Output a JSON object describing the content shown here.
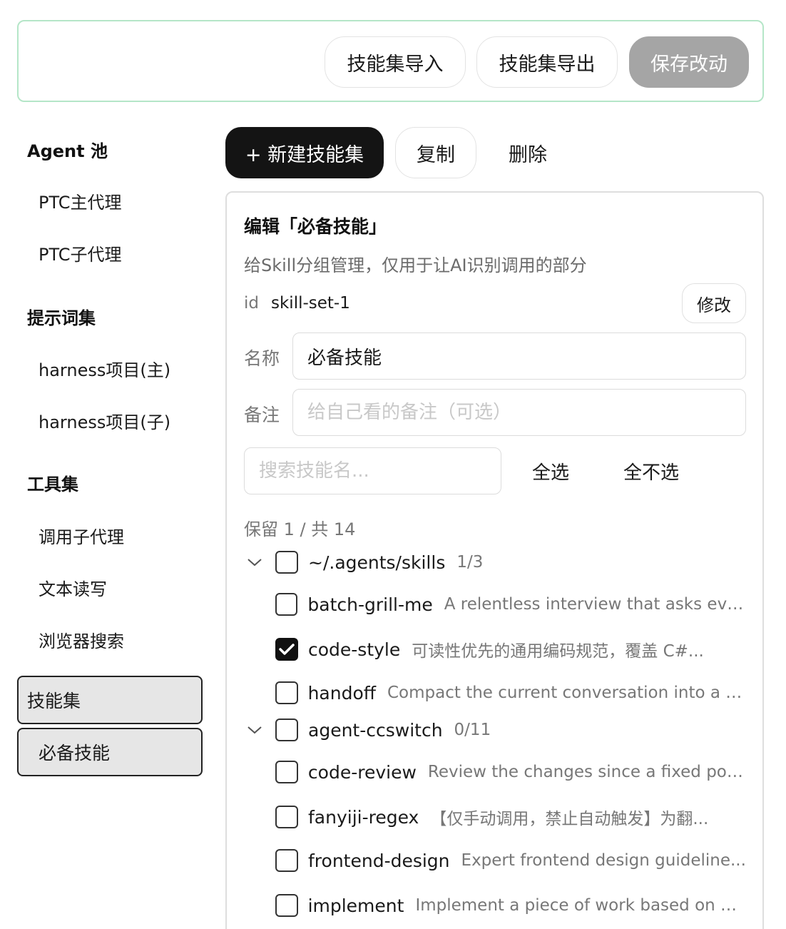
{
  "toolbar": {
    "import_label": "技能集导入",
    "export_label": "技能集导出",
    "save_label": "保存改动"
  },
  "sidebar": {
    "agent_pool_title": "Agent 池",
    "agent_items": [
      "PTC主代理",
      "PTC子代理"
    ],
    "prompt_title": "提示词集",
    "prompt_items": [
      "harness项目(主)",
      "harness项目(子)"
    ],
    "tool_title": "工具集",
    "tool_items": [
      "调用子代理",
      "文本读写",
      "浏览器搜索"
    ],
    "skill_title": "技能集",
    "skill_items": [
      "必备技能"
    ]
  },
  "actions": {
    "new_label": "+ 新建技能集",
    "copy_label": "复制",
    "delete_label": "删除"
  },
  "editor": {
    "title": "编辑「必备技能」",
    "description": "给Skill分组管理，仅用于让AI识别调用的部分",
    "id_label": "id",
    "id_value": "skill-set-1",
    "modify_label": "修改",
    "name_label": "名称",
    "name_value": "必备技能",
    "note_label": "备注",
    "note_placeholder": "给自己看的备注（可选）",
    "search_placeholder": "搜索技能名...",
    "select_all_label": "全选",
    "select_none_label": "全不选",
    "keep_count": "保留 1 / 共 14"
  },
  "groups": [
    {
      "name": "~/.agents/skills",
      "count": "1/3",
      "expanded": true,
      "checked": false,
      "skills": [
        {
          "name": "batch-grill-me",
          "desc": "A relentless interview that asks eve...",
          "checked": false
        },
        {
          "name": "code-style",
          "desc": "可读性优先的通用编码规范，覆盖 C#...",
          "checked": true
        },
        {
          "name": "handoff",
          "desc": "Compact the current conversation into a h...",
          "checked": false
        }
      ]
    },
    {
      "name": "agent-ccswitch",
      "count": "0/11",
      "expanded": true,
      "checked": false,
      "skills": [
        {
          "name": "code-review",
          "desc": "Review the changes since a fixed poi...",
          "checked": false
        },
        {
          "name": "fanyiji-regex",
          "desc": "【仅手动调用，禁止自动触发】为翻...",
          "checked": false
        },
        {
          "name": "frontend-design",
          "desc": "Expert frontend design guideline...",
          "checked": false
        },
        {
          "name": "implement",
          "desc": "Implement a piece of work based on a ...",
          "checked": false
        }
      ]
    }
  ],
  "icons": {
    "chevron": "chevron-down-icon",
    "check": "check-icon"
  },
  "colors": {
    "top_border": "#b5e6c8",
    "primary_button": "#141414",
    "save_disabled": "#a5a5a5",
    "selected_item_bg": "#e6e6e6"
  }
}
